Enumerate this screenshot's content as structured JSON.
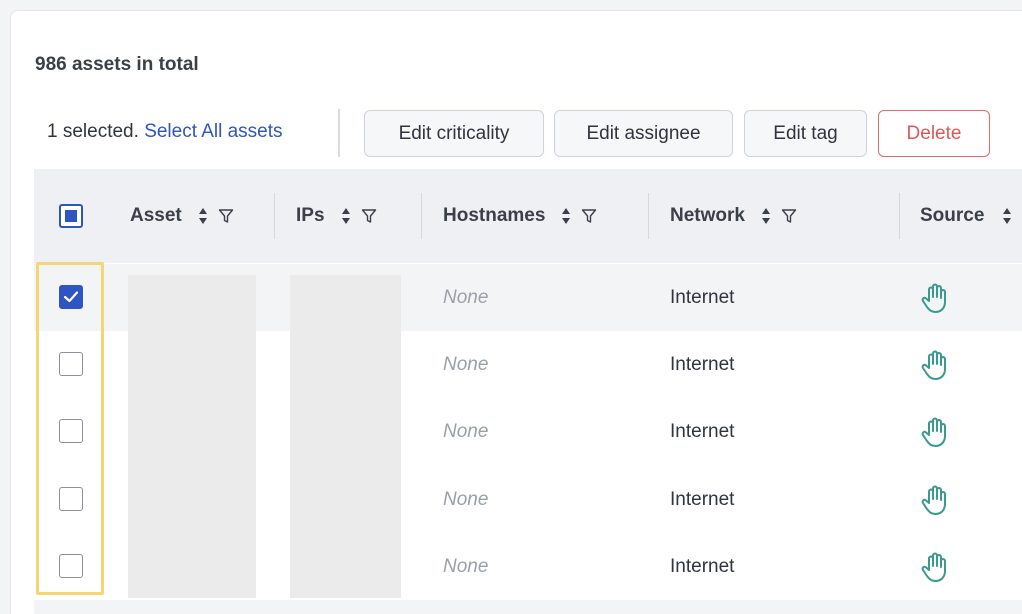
{
  "summary": {
    "total_text": "986 assets in total"
  },
  "selection": {
    "count_text": "1 selected.",
    "select_all_link": "Select All assets"
  },
  "actions": {
    "edit_criticality": "Edit criticality",
    "edit_assignee": "Edit assignee",
    "edit_tag": "Edit tag",
    "delete": "Delete"
  },
  "columns": [
    {
      "label": "Asset",
      "sortable": true,
      "filterable": true
    },
    {
      "label": "IPs",
      "sortable": true,
      "filterable": true
    },
    {
      "label": "Hostnames",
      "sortable": true,
      "filterable": true
    },
    {
      "label": "Network",
      "sortable": true,
      "filterable": true
    },
    {
      "label": "Source",
      "sortable": true,
      "filterable": false
    }
  ],
  "header_checkbox_state": "indeterminate",
  "rows": [
    {
      "checked": true,
      "hostnames": "None",
      "network": "Internet",
      "source_icon": "hand-icon"
    },
    {
      "checked": false,
      "hostnames": "None",
      "network": "Internet",
      "source_icon": "hand-icon"
    },
    {
      "checked": false,
      "hostnames": "None",
      "network": "Internet",
      "source_icon": "hand-icon"
    },
    {
      "checked": false,
      "hostnames": "None",
      "network": "Internet",
      "source_icon": "hand-icon"
    },
    {
      "checked": false,
      "hostnames": "None",
      "network": "Internet",
      "source_icon": "hand-icon"
    }
  ],
  "colors": {
    "accent": "#2f55c2",
    "danger": "#e05757",
    "source_icon": "#3a9a8f",
    "highlight": "#f5d574"
  }
}
